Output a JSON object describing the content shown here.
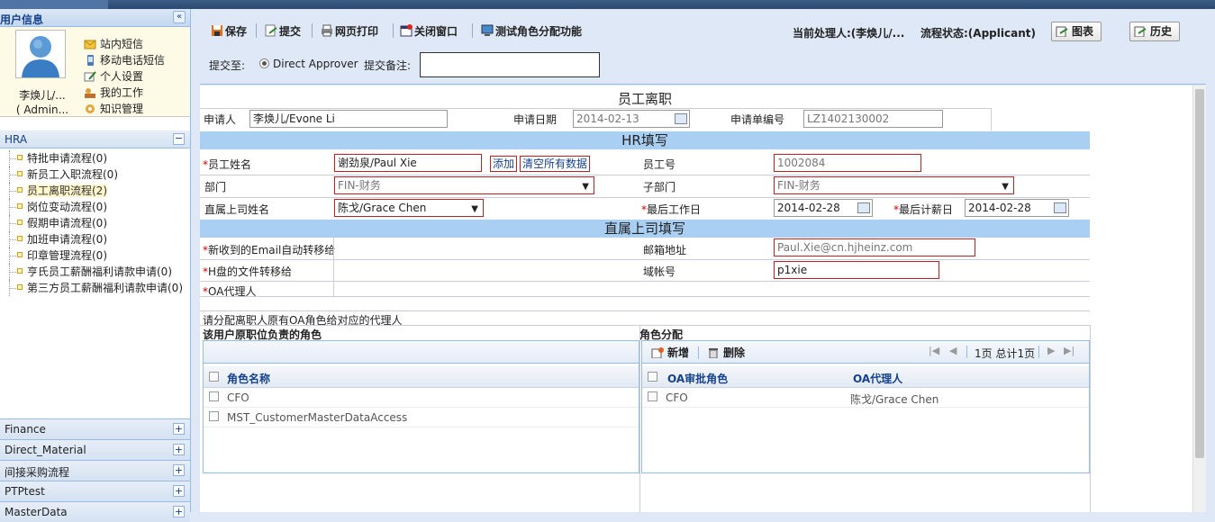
{
  "sidebar": {
    "user_header": "用户信息",
    "user_name": "李焕儿/...",
    "user_role": "( Admin...",
    "menu": [
      "站内短信",
      "移动电话短信",
      "个人设置",
      "我的工作",
      "知识管理"
    ],
    "hra_title": "HRA",
    "tree": [
      {
        "label": "特批申请流程(0)"
      },
      {
        "label": "新员工入职流程(0)"
      },
      {
        "label": "员工离职流程(2)"
      },
      {
        "label": "岗位变动流程(0)"
      },
      {
        "label": "假期申请流程(0)"
      },
      {
        "label": "加班申请流程(0)"
      },
      {
        "label": "印章管理流程(0)"
      },
      {
        "label": "亨氏员工薪酬福利请款申请(0)"
      },
      {
        "label": "第三方员工薪酬福利请款申请(0)"
      }
    ],
    "accordions": [
      "Finance",
      "Direct_Material",
      "间接采购流程",
      "PTPtest",
      "MasterData"
    ]
  },
  "toolbar": {
    "save": "保存",
    "submit": "提交",
    "print": "网页打印",
    "close": "关闭窗口",
    "test": "测试角色分配功能",
    "handler": "当前处理人:(李焕儿/...",
    "status": "流程状态:(Applicant)",
    "chart": "图表",
    "history": "历史",
    "submit_to_label": "提交至:",
    "submit_to_value": "Direct Approver",
    "remark_label": "提交备注:"
  },
  "form": {
    "title": "员工离职",
    "applicant_label": "申请人",
    "applicant": "李焕儿/Evone Li",
    "date_label": "申请日期",
    "date": "2014-02-13",
    "no_label": "申请单编号",
    "no": "LZ1402130002",
    "hr_section": "HR填写",
    "emp_name_label": "员工姓名",
    "emp_name": "谢劲泉/Paul Xie",
    "add": "添加",
    "clear": "清空所有数据",
    "emp_no_label": "员工号",
    "emp_no": "1002084",
    "dept_label": "部门",
    "dept": "FIN-财务",
    "subdept_label": "子部门",
    "subdept": "FIN-财务",
    "manager_label": "直属上司姓名",
    "manager": "陈戈/Grace Chen",
    "lastwork_label": "最后工作日",
    "lastwork": "2014-02-28",
    "lastpay_label": "最后计薪日",
    "lastpay": "2014-02-28",
    "mgr_section": "直属上司填写",
    "email_fwd_label": "新收到的Email自动转移给",
    "email_label": "邮箱地址",
    "email": "Paul.Xie@cn.hjheinz.com",
    "hdisk_label": "H盘的文件转移给",
    "domain_label": "域帐号",
    "domain": "p1xie",
    "oa_label": "OA代理人",
    "assign_note": "请分配离职人原有OA角色给对应的代理人",
    "orig_roles_label": "该用户原职位负责的角色",
    "assign_label": "角色分配"
  },
  "left_grid": {
    "header": "角色名称",
    "rows": [
      "CFO",
      "MST_CustomerMasterDataAccess"
    ]
  },
  "right_grid": {
    "add": "新增",
    "delete": "删除",
    "pager": "1页 总计1页",
    "headers": [
      "OA审批角色",
      "OA代理人"
    ],
    "rows": [
      {
        "role": "CFO",
        "agent": "陈戈/Grace Chen"
      }
    ]
  }
}
